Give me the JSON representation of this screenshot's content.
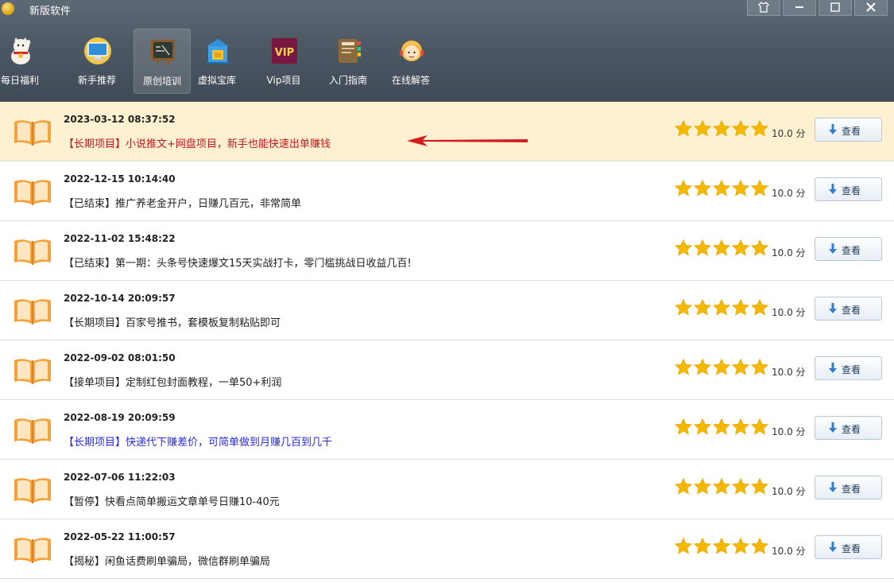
{
  "window": {
    "title": "新版软件"
  },
  "toolbar": {
    "items": [
      {
        "label": "每日福利",
        "icon": "lucky-cat-icon"
      },
      {
        "label": "新手推荐",
        "icon": "monitor-icon"
      },
      {
        "label": "原创培训",
        "icon": "blackboard-icon",
        "active": true
      },
      {
        "label": "虚拟宝库",
        "icon": "building-icon"
      },
      {
        "label": "Vip项目",
        "icon": "vip-badge-icon",
        "badge_text": "VIP"
      },
      {
        "label": "入门指南",
        "icon": "guide-book-icon"
      },
      {
        "label": "在线解答",
        "icon": "support-agent-icon"
      }
    ]
  },
  "list": {
    "score_suffix": "分",
    "view_label": "查看",
    "rows": [
      {
        "date": "2023-03-12 08:37:52",
        "title": "【长期项目】小说推文+网盘项目，新手也能快速出单赚钱",
        "score": "10.0",
        "stars": 5,
        "title_color": "red",
        "highlight": true
      },
      {
        "date": "2022-12-15 10:14:40",
        "title": "【已结束】推广养老金开户，日赚几百元，非常简单",
        "score": "10.0",
        "stars": 5
      },
      {
        "date": "2022-11-02 15:48:22",
        "title": "【已结束】第一期：头条号快速爆文15天实战打卡，零门槛挑战日收益几百!",
        "score": "10.0",
        "stars": 5
      },
      {
        "date": "2022-10-14 20:09:57",
        "title": "【长期项目】百家号推书，套模板复制粘贴即可",
        "score": "10.0",
        "stars": 5
      },
      {
        "date": "2022-09-02 08:01:50",
        "title": "【接单项目】定制红包封面教程，一单50+利润",
        "score": "10.0",
        "stars": 5
      },
      {
        "date": "2022-08-19 20:09:59",
        "title": "【长期项目】快递代下赚差价，可简单做到月赚几百到几千",
        "score": "10.0",
        "stars": 5,
        "title_color": "blue"
      },
      {
        "date": "2022-07-06 11:22:03",
        "title": "【暂停】快看点简单搬运文章单号日赚10-40元",
        "score": "10.0",
        "stars": 5
      },
      {
        "date": "2022-05-22 11:00:57",
        "title": "【揭秘】闲鱼话费刷单骗局，微信群刷单骗局",
        "score": "10.0",
        "stars": 5
      }
    ]
  },
  "colors": {
    "accent_red": "#c4161c",
    "accent_blue": "#2b2bd6",
    "star": "#f5b800",
    "highlight_row": "#fdf1d2"
  }
}
